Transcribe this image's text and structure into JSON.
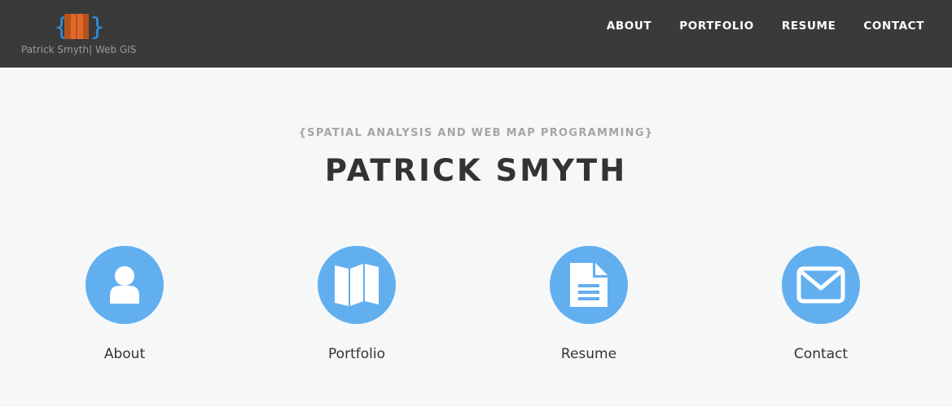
{
  "header": {
    "brand_text": "Patrick Smyth| Web GIS",
    "brand_colors": {
      "brace": "#2f8fdf",
      "book": "#e0692a",
      "book_dark": "#b8521d"
    },
    "nav": [
      {
        "label": "ABOUT"
      },
      {
        "label": "PORTFOLIO"
      },
      {
        "label": "RESUME"
      },
      {
        "label": "CONTACT"
      }
    ]
  },
  "hero": {
    "subtitle": "{SPATIAL ANALYSIS AND WEB MAP PROGRAMMING}",
    "title": "PATRICK SMYTH"
  },
  "features": [
    {
      "label": "About",
      "icon": "user-icon"
    },
    {
      "label": "Portfolio",
      "icon": "map-icon"
    },
    {
      "label": "Resume",
      "icon": "document-icon"
    },
    {
      "label": "Contact",
      "icon": "envelope-icon"
    }
  ],
  "colors": {
    "navbar_bg": "#3a3a3a",
    "page_bg": "#f6f8f8",
    "accent": "#62aff0",
    "title": "#333333",
    "subtitle": "#a5a5a5"
  }
}
